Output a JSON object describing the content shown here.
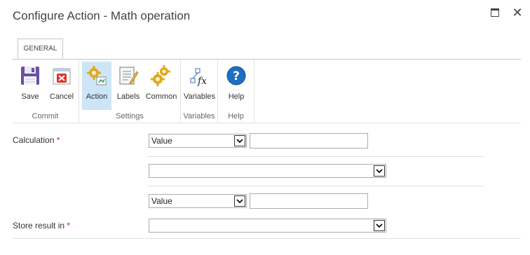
{
  "window": {
    "title": "Configure Action - Math operation",
    "maximize_icon": "maximize-icon",
    "close_label": "✕"
  },
  "ribbon": {
    "tab": "GENERAL",
    "groups": [
      {
        "label": "Commit",
        "buttons": [
          {
            "label": "Save",
            "icon": "save-disk-icon"
          },
          {
            "label": "Cancel",
            "icon": "cancel-x-icon"
          }
        ]
      },
      {
        "label": "Settings",
        "buttons": [
          {
            "label": "Action",
            "icon": "action-gears-icon",
            "selected": true
          },
          {
            "label": "Labels",
            "icon": "labels-notepad-icon"
          },
          {
            "label": "Common",
            "icon": "common-gears-icon"
          }
        ]
      },
      {
        "label": "Variables",
        "buttons": [
          {
            "label": "Variables",
            "icon": "variables-fx-icon"
          }
        ]
      },
      {
        "label": "Help",
        "buttons": [
          {
            "label": "Help",
            "icon": "help-question-icon"
          }
        ]
      }
    ]
  },
  "form": {
    "calculation_label": "Calculation",
    "store_result_label": "Store result in",
    "required_marker": "*",
    "operand1_type": "Value",
    "operand1_value": "",
    "operator_value": "",
    "operand2_type": "Value",
    "operand2_value": "",
    "store_result_value": ""
  },
  "colors": {
    "selected_button_bg": "#cde6f7",
    "required": "#c1272d",
    "help_blue": "#1e6fc4",
    "cancel_red": "#d9342b"
  }
}
